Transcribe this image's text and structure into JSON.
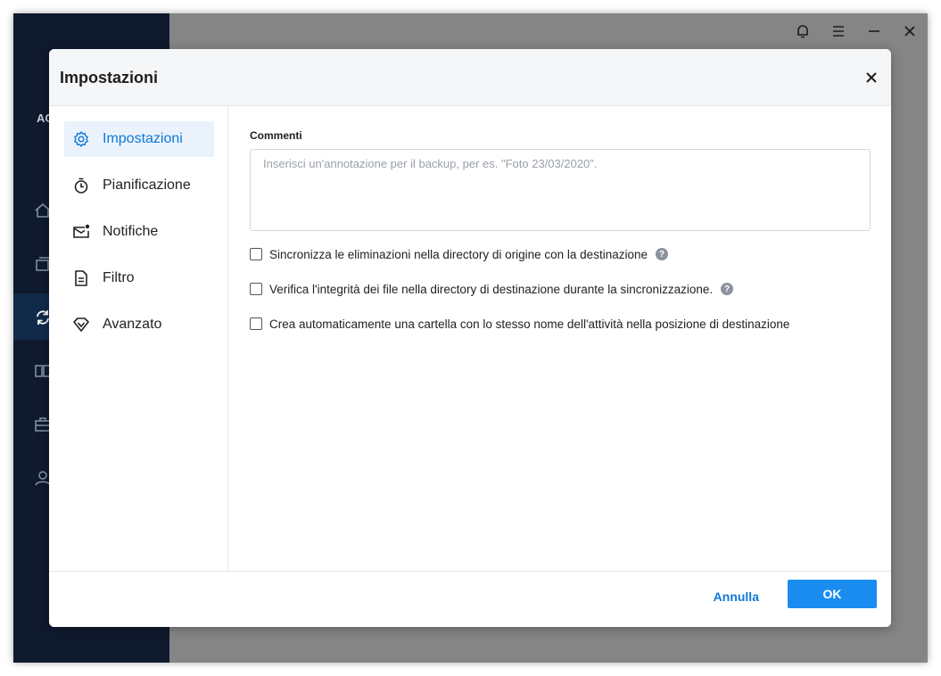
{
  "app": {
    "brand_partial": "AO"
  },
  "dialog": {
    "title": "Impostazioni",
    "nav": [
      {
        "label": "Impostazioni",
        "icon": "gear-icon",
        "active": true
      },
      {
        "label": "Pianificazione",
        "icon": "timer-icon",
        "active": false
      },
      {
        "label": "Notifiche",
        "icon": "mail-notification-icon",
        "active": false
      },
      {
        "label": "Filtro",
        "icon": "document-filter-icon",
        "active": false
      },
      {
        "label": "Avanzato",
        "icon": "diamond-icon",
        "active": false
      }
    ],
    "comments": {
      "label": "Commenti",
      "value": "",
      "placeholder": "Inserisci un'annotazione per il backup, per es. \"Foto 23/03/2020\"."
    },
    "options": [
      {
        "label": "Sincronizza le eliminazioni nella directory di origine con la destinazione",
        "checked": false,
        "help": true
      },
      {
        "label": "Verifica l'integrità dei file nella directory di destinazione durante la sincronizzazione.",
        "checked": false,
        "help": true
      },
      {
        "label": "Crea automaticamente una cartella con lo stesso nome dell'attività nella posizione di destinazione",
        "checked": false,
        "help": false
      }
    ],
    "help_glyph": "?",
    "footer": {
      "cancel_label": "Annulla",
      "ok_label": "OK"
    }
  },
  "colors": {
    "accent": "#1078d6",
    "ok_button": "#1a8cf0",
    "sidebar_bg": "#0f1a2e"
  }
}
